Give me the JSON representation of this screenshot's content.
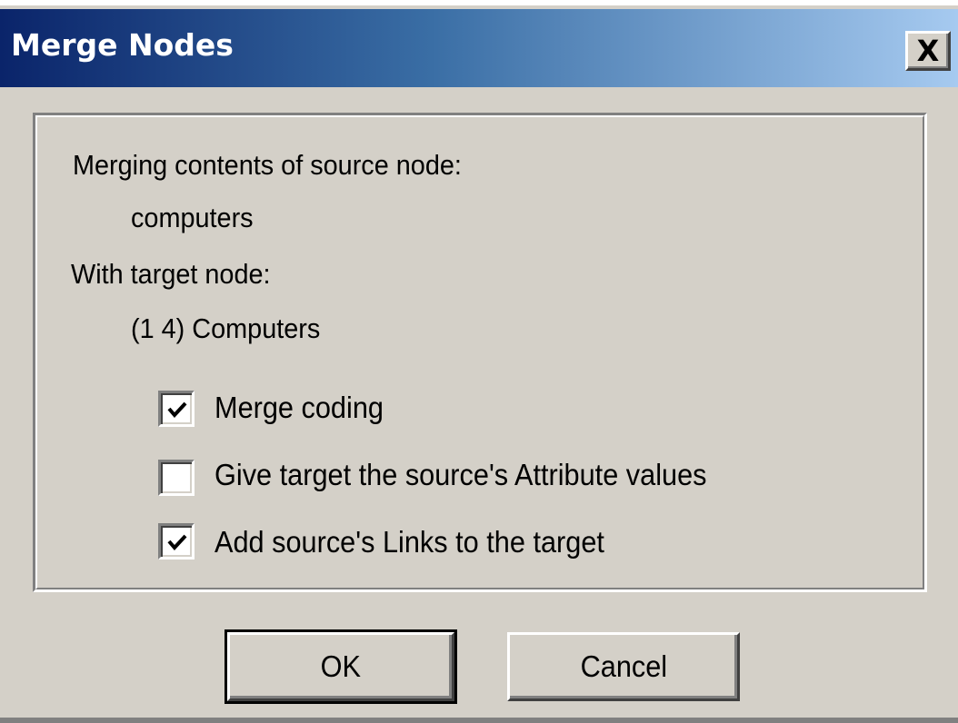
{
  "window": {
    "title": "Merge Nodes",
    "close_glyph": "X",
    "close_icon": "close-icon"
  },
  "content": {
    "source_label": "Merging contents of source node:",
    "source_value": "computers",
    "target_label": "With target node:",
    "target_value": "(1 4) Computers"
  },
  "options": [
    {
      "label": "Merge coding",
      "checked": true
    },
    {
      "label": "Give target the source's Attribute values",
      "checked": false
    },
    {
      "label": "Add source's Links to the target",
      "checked": true
    }
  ],
  "buttons": {
    "ok": "OK",
    "cancel": "Cancel"
  },
  "colors": {
    "title_gradient_start": "#0a246a",
    "title_gradient_end": "#a6caf0",
    "face": "#d4d0c8"
  }
}
